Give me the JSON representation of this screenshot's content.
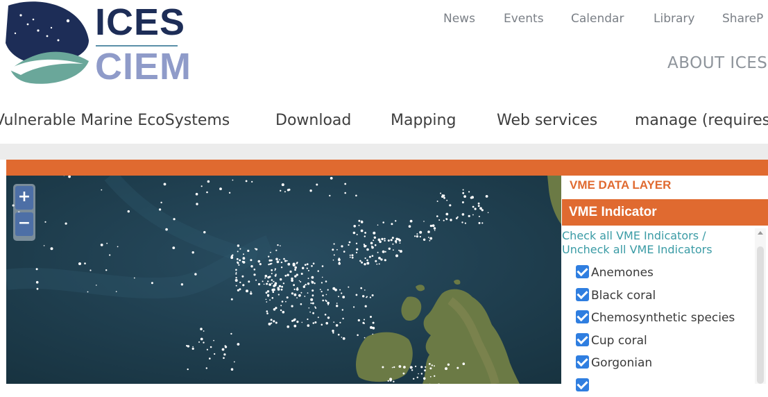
{
  "logo": {
    "line1": "ICES",
    "line2": "CIEM"
  },
  "top_nav": [
    "News",
    "Events",
    "Calendar",
    "Library",
    "ShareP"
  ],
  "about_link": "ABOUT ICES",
  "main_nav": [
    "Vulnerable Marine EcoSystems",
    "Download",
    "Mapping",
    "Web services",
    "manage (requires"
  ],
  "map": {
    "zoom_in": "+",
    "zoom_out": "−",
    "colors": {
      "sea": "#1e3e52",
      "land": "#6b7a45",
      "points": "#ffffff"
    }
  },
  "panel": {
    "title": "VME DATA LAYER",
    "header": "VME Indicator",
    "check_all": "Check all VME Indicators /",
    "uncheck_all": "Uncheck all VME Indicators",
    "indicators": [
      "Anemones",
      "Black coral",
      "Chemosynthetic species",
      "Cup coral",
      "Gorgonian"
    ]
  },
  "colors": {
    "accent": "#e06a30",
    "link": "#3a9ba5",
    "checkbox": "#2f7ee0"
  }
}
